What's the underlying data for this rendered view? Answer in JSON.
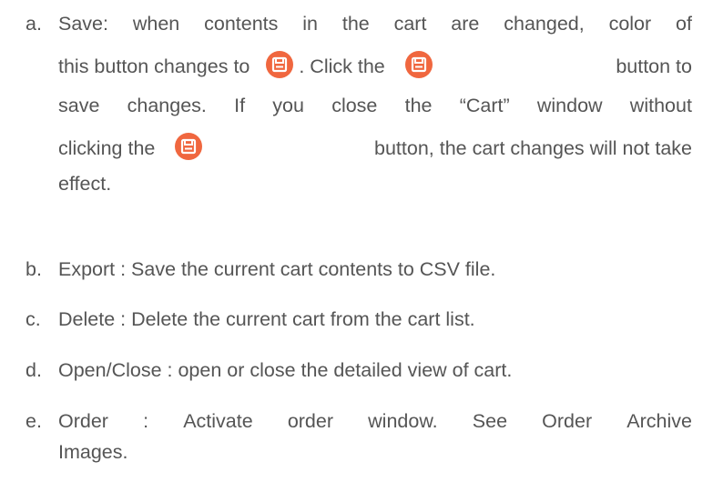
{
  "items": [
    {
      "marker": "a.",
      "lines": [
        [
          "Save:",
          "when",
          "contents",
          "in",
          "the",
          "cart",
          "are",
          "changed,",
          "color",
          "of"
        ],
        [
          "this button changes to",
          ". Click the",
          "button to"
        ],
        [
          "save",
          "changes.",
          "If",
          "you",
          "close",
          "the",
          "“Cart”",
          "window",
          "without"
        ],
        [
          "clicking the",
          "button, the cart changes will not take"
        ],
        [
          "effect."
        ]
      ]
    },
    {
      "marker": "b.",
      "text": "Export : Save the current cart contents to CSV file."
    },
    {
      "marker": "c.",
      "text": "Delete : Delete the current cart from the cart list."
    },
    {
      "marker": "d.",
      "text": "Open/Close : open or close the detailed view of cart."
    },
    {
      "marker": "e.",
      "lines": [
        [
          "Order",
          ":",
          "Activate",
          "order",
          "window.",
          "See",
          "Order",
          "Archive"
        ],
        [
          "Images."
        ]
      ]
    }
  ],
  "icon": {
    "name": "save-icon",
    "color": "#f0673f"
  }
}
